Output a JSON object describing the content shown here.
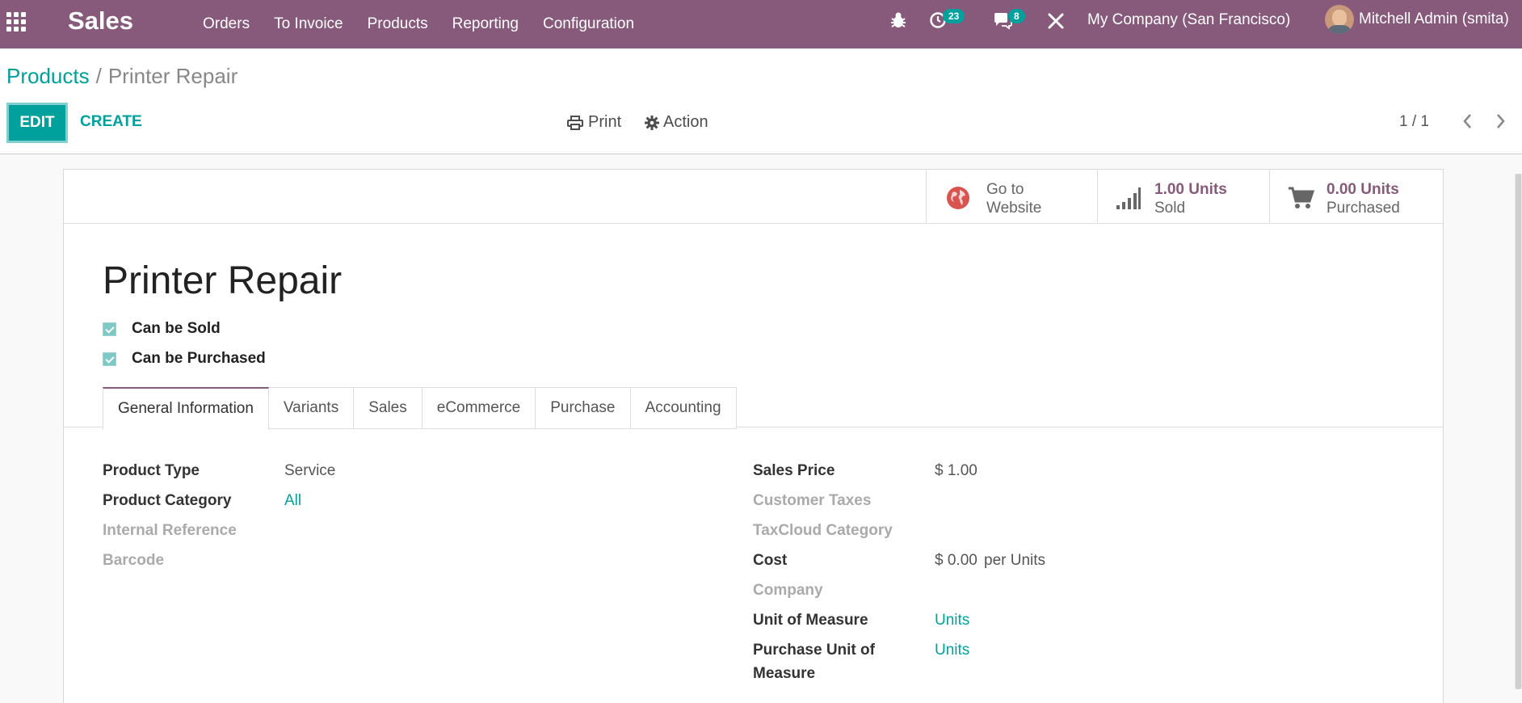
{
  "navbar": {
    "app_name": "Sales",
    "menu": [
      "Orders",
      "To Invoice",
      "Products",
      "Reporting",
      "Configuration"
    ],
    "activity_count": "23",
    "message_count": "8",
    "company": "My Company (San Francisco)",
    "user": "Mitchell Admin (smita)",
    "color": "#875a7b"
  },
  "breadcrumb": {
    "parent": "Products",
    "separator": "/",
    "current": "Printer Repair"
  },
  "toolbar": {
    "edit": "EDIT",
    "create": "CREATE",
    "print": "Print",
    "action": "Action",
    "pager": "1 / 1"
  },
  "smart_buttons": {
    "website": {
      "line1": "Go to",
      "line2": "Website"
    },
    "sold": {
      "value": "1.00 Units",
      "label": "Sold"
    },
    "purchased": {
      "value": "0.00 Units",
      "label": "Purchased"
    }
  },
  "product": {
    "name": "Printer Repair",
    "can_be_sold": "Can be Sold",
    "can_be_purchased": "Can be Purchased"
  },
  "tabs": [
    "General Information",
    "Variants",
    "Sales",
    "eCommerce",
    "Purchase",
    "Accounting"
  ],
  "fields_left": {
    "product_type": {
      "label": "Product Type",
      "value": "Service"
    },
    "product_category": {
      "label": "Product Category",
      "value": "All"
    },
    "internal_reference": {
      "label": "Internal Reference"
    },
    "barcode": {
      "label": "Barcode"
    }
  },
  "fields_right": {
    "sales_price": {
      "label": "Sales Price",
      "value": "$ 1.00"
    },
    "customer_taxes": {
      "label": "Customer Taxes"
    },
    "taxcloud_category": {
      "label": "TaxCloud Category"
    },
    "cost": {
      "label": "Cost",
      "value": "$ 0.00",
      "suffix": "per Units"
    },
    "company": {
      "label": "Company"
    },
    "uom": {
      "label": "Unit of Measure",
      "value": "Units"
    },
    "purchase_uom": {
      "label_line1": "Purchase Unit of",
      "label_line2": "Measure",
      "value": "Units"
    }
  },
  "accent_color": "#00a09d"
}
